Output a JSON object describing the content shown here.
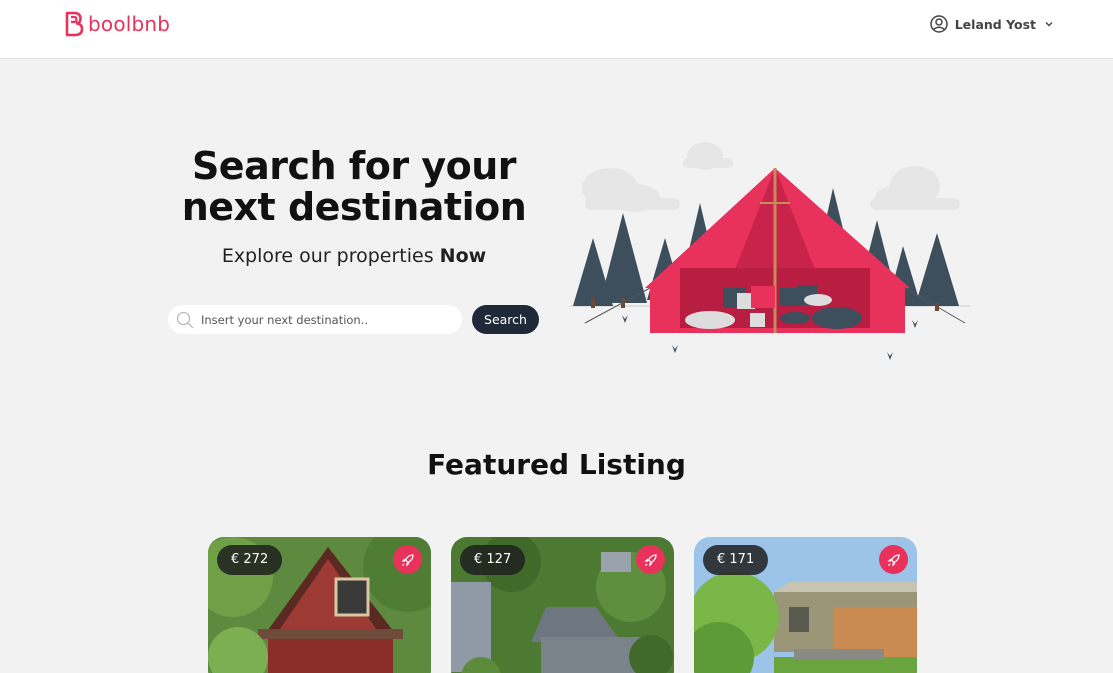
{
  "brand": {
    "name": "boolbnb",
    "color": "#e8315b"
  },
  "header": {
    "user_name": "Leland Yost",
    "user_icon": "user-circle-icon",
    "menu_icon": "chevron-down-icon"
  },
  "hero": {
    "title": "Search for your next destination",
    "subtitle_prefix": "Explore our properties",
    "subtitle_emphasis": "Now",
    "search": {
      "placeholder": "Insert your next destination..",
      "value": "",
      "button_label": "Search"
    },
    "illustration": "camping-tent-illustration"
  },
  "featured": {
    "title": "Featured Listing",
    "listings": [
      {
        "price": "€ 272",
        "boost_icon": "rocket-icon",
        "image": "red-wooden-house"
      },
      {
        "price": "€ 127",
        "boost_icon": "rocket-icon",
        "image": "aerial-houses-trees"
      },
      {
        "price": "€ 171",
        "boost_icon": "rocket-icon",
        "image": "house-with-fence-garden"
      }
    ]
  },
  "colors": {
    "accent": "#e8315b",
    "dark_button": "#1f2937",
    "background": "#f2f2f2"
  }
}
